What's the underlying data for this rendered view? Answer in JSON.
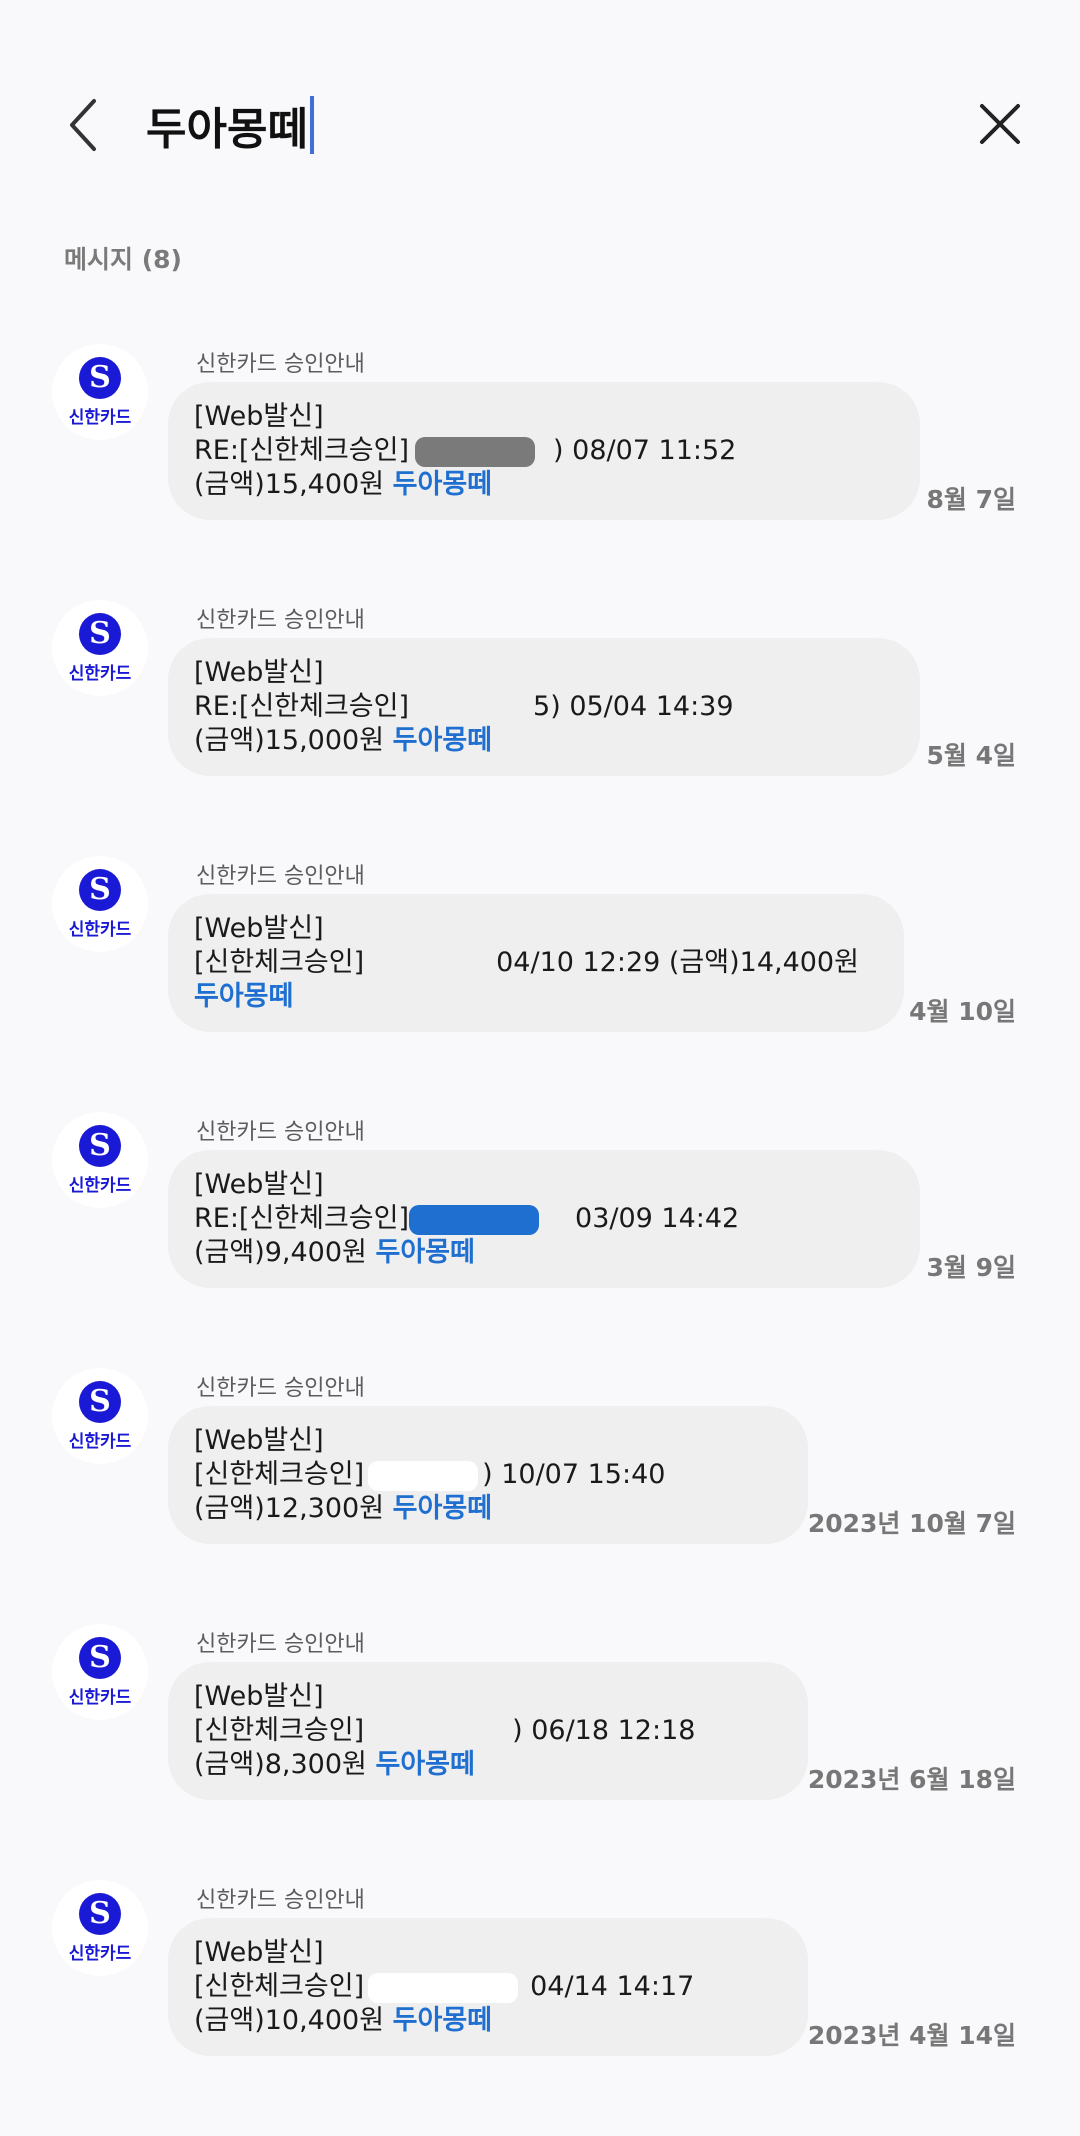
{
  "search": {
    "query": "두아몽떼"
  },
  "section": {
    "label": "메시지 (8)"
  },
  "messages": [
    {
      "sender": "신한카드 승인안내",
      "avatar_text": "신한카드",
      "line1": "[Web발신]",
      "line2_prefix": "RE:[신한체크승인]",
      "line2_suffix": ") 08/07 11:52",
      "line3_amount": "(금액)15,400원",
      "highlight": "두아몽떼",
      "date": "8월 7일"
    },
    {
      "sender": "신한카드 승인안내",
      "avatar_text": "신한카드",
      "line1": "[Web발신]",
      "line2_prefix": "RE:[신한체크승인]",
      "line2_suffix": "5) 05/04 14:39",
      "line3_amount": "(금액)15,000원",
      "highlight": "두아몽떼",
      "date": "5월 4일"
    },
    {
      "sender": "신한카드 승인안내",
      "avatar_text": "신한카드",
      "line1": "[Web발신]",
      "line2_prefix": "[신한체크승인]",
      "line2_suffix": "04/10 12:29 (금액)14,400원",
      "line3_amount": "",
      "highlight": "두아몽떼",
      "date": "4월 10일"
    },
    {
      "sender": "신한카드 승인안내",
      "avatar_text": "신한카드",
      "line1": "[Web발신]",
      "line2_prefix": "RE:[신한체크승인]",
      "line2_suffix": "03/09 14:42",
      "line3_amount": "(금액)9,400원",
      "highlight": "두아몽떼",
      "date": "3월 9일"
    },
    {
      "sender": "신한카드 승인안내",
      "avatar_text": "신한카드",
      "line1": "[Web발신]",
      "line2_prefix": "[신한체크승인]",
      "line2_suffix": ") 10/07 15:40",
      "line3_amount": "(금액)12,300원",
      "highlight": "두아몽떼",
      "date": "2023년 10월 7일"
    },
    {
      "sender": "신한카드 승인안내",
      "avatar_text": "신한카드",
      "line1": "[Web발신]",
      "line2_prefix": "[신한체크승인]",
      "line2_suffix": ") 06/18 12:18",
      "line3_amount": "(금액)8,300원",
      "highlight": "두아몽떼",
      "date": "2023년 6월 18일"
    },
    {
      "sender": "신한카드 승인안내",
      "avatar_text": "신한카드",
      "line1": "[Web발신]",
      "line2_prefix": "[신한체크승인]",
      "line2_suffix": "04/14 14:17",
      "line3_amount": "(금액)10,400원",
      "highlight": "두아몽떼",
      "date": "2023년 4월 14일"
    }
  ],
  "colors": {
    "background": "#f9f9fb",
    "bubble": "#efefef",
    "highlight": "#1f6fd1",
    "caret": "#3f6fd8",
    "brand": "#1a1ad6"
  },
  "icons": {
    "back": "chevron-left-icon",
    "close": "close-icon",
    "avatar_logo": "shinhan-card-logo"
  }
}
